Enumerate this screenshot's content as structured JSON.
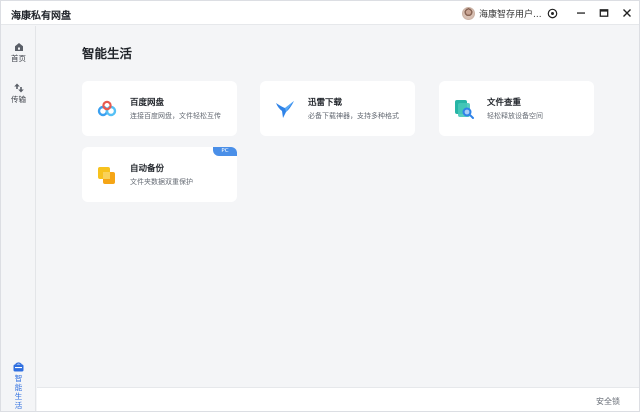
{
  "app": {
    "title": "海康私有网盘"
  },
  "user": {
    "name": "海康智存用户..."
  },
  "sidebar": {
    "items": [
      {
        "label": "首页"
      },
      {
        "label": "传输"
      },
      {
        "label": "智能生活",
        "active": true
      }
    ]
  },
  "main": {
    "title": "智能生活",
    "cards": [
      {
        "title": "百度网盘",
        "desc": "连接百度网盘，文件轻松互传",
        "icon": "baidu-cloud-icon"
      },
      {
        "title": "迅雷下载",
        "desc": "必备下载神器，支持多种格式",
        "icon": "xunlei-bird-icon"
      },
      {
        "title": "文件查重",
        "desc": "轻松释放设备空间",
        "icon": "file-search-icon"
      },
      {
        "title": "自动备份",
        "desc": "文件夹数据双重保护",
        "icon": "folder-backup-icon",
        "badge": "PC"
      }
    ]
  },
  "footer": {
    "lock_label": "安全锁"
  },
  "colors": {
    "accent": "#2f6fe0",
    "badge": "#4a8fe8",
    "background": "#f4f5f7"
  }
}
